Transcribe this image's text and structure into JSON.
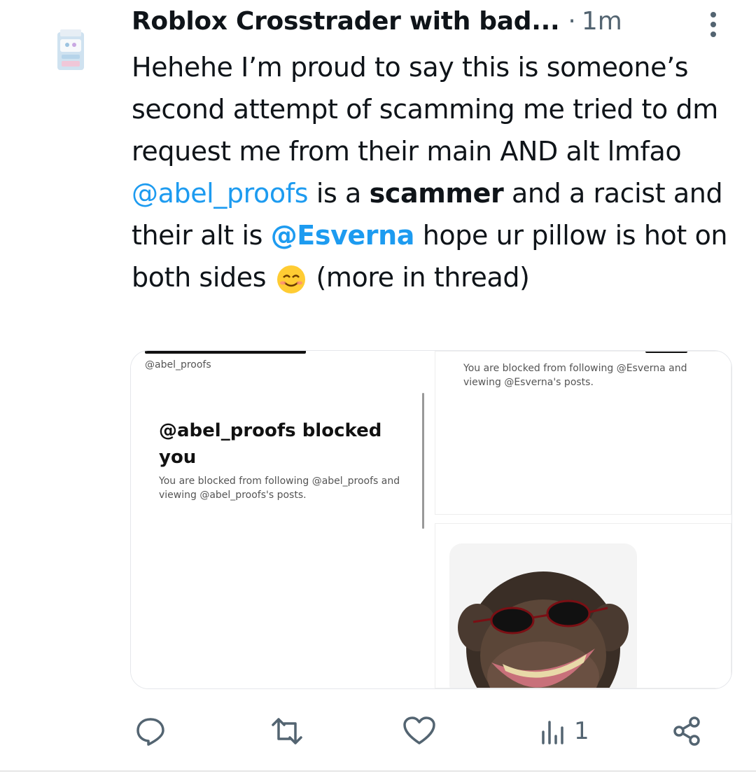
{
  "tweet": {
    "author": "Roblox Crosstrader with bad...",
    "separator": "·",
    "time": "1m",
    "text": {
      "part1": "Hehehe I’m proud to say this is someone’s second attempt of scamming me tried to dm request me from their main AND alt lmfao ",
      "mention1": "@abel_proofs",
      "part2": " is a ",
      "bold_word": "scammer",
      "part3": " and a racist and their alt is ",
      "mention2": "@Esverna",
      "part4": " hope ur pillow is hot on both sides ",
      "part5": " (more in thread)"
    }
  },
  "media": {
    "left": {
      "handle": "@abel_proofs",
      "title": "@abel_proofs blocked you",
      "subtitle": "You are blocked from following @abel_proofs and viewing @abel_proofs's posts."
    },
    "top_right": {
      "subtitle": "You are blocked from following @Esverna and viewing @Esverna's posts."
    }
  },
  "actions": {
    "views_count": "1"
  },
  "colors": {
    "accent": "#1d9bf0",
    "muted": "#536471",
    "text": "#0f1419"
  },
  "icons": [
    "reply-icon",
    "retweet-icon",
    "like-icon",
    "views-icon",
    "share-icon",
    "more-icon",
    "smiling-emoji"
  ]
}
